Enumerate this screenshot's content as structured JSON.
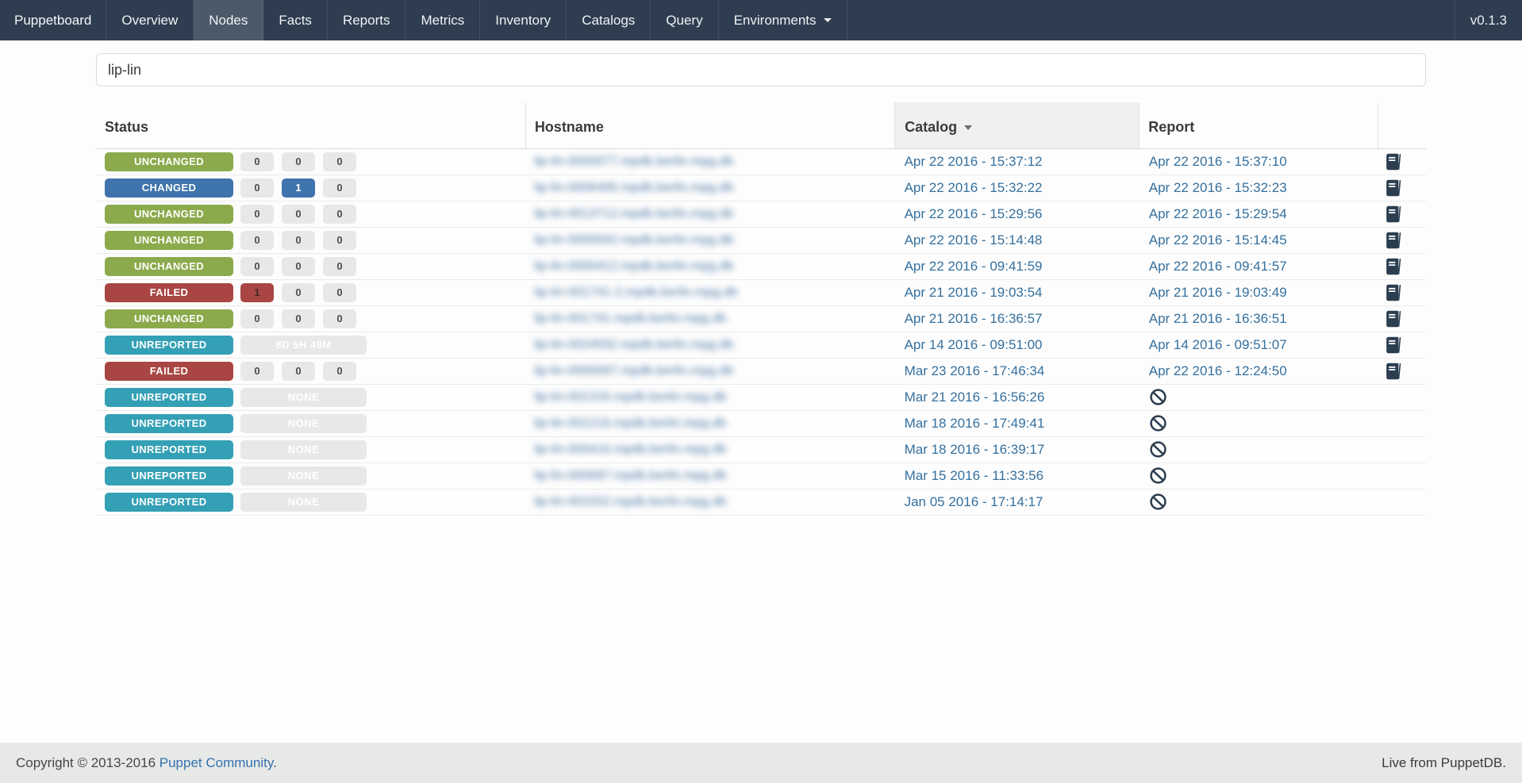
{
  "navbar": {
    "brand": "Puppetboard",
    "items": [
      {
        "label": "Overview",
        "active": false,
        "dropdown": false
      },
      {
        "label": "Nodes",
        "active": true,
        "dropdown": false
      },
      {
        "label": "Facts",
        "active": false,
        "dropdown": false
      },
      {
        "label": "Reports",
        "active": false,
        "dropdown": false
      },
      {
        "label": "Metrics",
        "active": false,
        "dropdown": false
      },
      {
        "label": "Inventory",
        "active": false,
        "dropdown": false
      },
      {
        "label": "Catalogs",
        "active": false,
        "dropdown": false
      },
      {
        "label": "Query",
        "active": false,
        "dropdown": false
      },
      {
        "label": "Environments",
        "active": false,
        "dropdown": true
      }
    ],
    "version": "v0.1.3"
  },
  "search": {
    "value": "lip-lin",
    "placeholder": ""
  },
  "table": {
    "headers": {
      "status": "Status",
      "hostname": "Hostname",
      "catalog": "Catalog",
      "report": "Report"
    },
    "sorted_column": "catalog",
    "sort_direction": "desc",
    "hostnames_redacted": true,
    "rows": [
      {
        "status": "UNCHANGED",
        "status_key": "unchanged",
        "counts": [
          {
            "v": "0"
          },
          {
            "v": "0"
          },
          {
            "v": "0"
          }
        ],
        "hostname": "lip-lin-0000077.mpdb.berlin.mpg.db",
        "catalog": "Apr 22 2016 - 15:37:12",
        "report": "Apr 22 2016 - 15:37:10",
        "has_report_doc": true
      },
      {
        "status": "CHANGED",
        "status_key": "changed",
        "counts": [
          {
            "v": "0"
          },
          {
            "v": "1",
            "t": "changed"
          },
          {
            "v": "0"
          }
        ],
        "hostname": "lip-lin-0006495.mpdb.berlin.mpg.db",
        "catalog": "Apr 22 2016 - 15:32:22",
        "report": "Apr 22 2016 - 15:32:23",
        "has_report_doc": true
      },
      {
        "status": "UNCHANGED",
        "status_key": "unchanged",
        "counts": [
          {
            "v": "0"
          },
          {
            "v": "0"
          },
          {
            "v": "0"
          }
        ],
        "hostname": "lip-lin-0013712.mpdb.berlin.mpg.db",
        "catalog": "Apr 22 2016 - 15:29:56",
        "report": "Apr 22 2016 - 15:29:54",
        "has_report_doc": true
      },
      {
        "status": "UNCHANGED",
        "status_key": "unchanged",
        "counts": [
          {
            "v": "0"
          },
          {
            "v": "0"
          },
          {
            "v": "0"
          }
        ],
        "hostname": "lip-lin-0009592.mpdb.berlin.mpg.db",
        "catalog": "Apr 22 2016 - 15:14:48",
        "report": "Apr 22 2016 - 15:14:45",
        "has_report_doc": true
      },
      {
        "status": "UNCHANGED",
        "status_key": "unchanged",
        "counts": [
          {
            "v": "0"
          },
          {
            "v": "0"
          },
          {
            "v": "0"
          }
        ],
        "hostname": "lip-lin-0000412.mpdb.berlin.mpg.db",
        "catalog": "Apr 22 2016 - 09:41:59",
        "report": "Apr 22 2016 - 09:41:57",
        "has_report_doc": true
      },
      {
        "status": "FAILED",
        "status_key": "failed",
        "counts": [
          {
            "v": "1",
            "t": "failed"
          },
          {
            "v": "0"
          },
          {
            "v": "0"
          }
        ],
        "hostname": "lip-lin-001741-2.mpdb.berlin.mpg.db",
        "catalog": "Apr 21 2016 - 19:03:54",
        "report": "Apr 21 2016 - 19:03:49",
        "has_report_doc": true
      },
      {
        "status": "UNCHANGED",
        "status_key": "unchanged",
        "counts": [
          {
            "v": "0"
          },
          {
            "v": "0"
          },
          {
            "v": "0"
          }
        ],
        "hostname": "lip-lin-001741.mpdb.berlin.mpg.db",
        "catalog": "Apr 21 2016 - 16:36:57",
        "report": "Apr 21 2016 - 16:36:51",
        "has_report_doc": true
      },
      {
        "status": "UNREPORTED",
        "status_key": "unreported",
        "wide_count": "8D 5H 49M",
        "hostname": "lip-lin-0024592.mpdb.berlin.mpg.db",
        "catalog": "Apr 14 2016 - 09:51:00",
        "report": "Apr 14 2016 - 09:51:07",
        "has_report_doc": true
      },
      {
        "status": "FAILED",
        "status_key": "failed",
        "counts": [
          {
            "v": "0"
          },
          {
            "v": "0"
          },
          {
            "v": "0"
          }
        ],
        "hostname": "lip-lin-0000097.mpdb.berlin.mpg.db",
        "catalog": "Mar 23 2016 - 17:46:34",
        "report": "Apr 22 2016 - 12:24:50",
        "has_report_doc": true
      },
      {
        "status": "UNREPORTED",
        "status_key": "unreported",
        "wide_count": "NONE",
        "hostname": "lip-lin-001316.mpdb.berlin.mpg.db",
        "catalog": "Mar 21 2016 - 16:56:26",
        "report": null,
        "has_report_doc": false
      },
      {
        "status": "UNREPORTED",
        "status_key": "unreported",
        "wide_count": "NONE",
        "hostname": "lip-lin-001216.mpdb.berlin.mpg.db",
        "catalog": "Mar 18 2016 - 17:49:41",
        "report": null,
        "has_report_doc": false
      },
      {
        "status": "UNREPORTED",
        "status_key": "unreported",
        "wide_count": "NONE",
        "hostname": "lip-lin-000416.mpdb.berlin.mpg.db",
        "catalog": "Mar 18 2016 - 16:39:17",
        "report": null,
        "has_report_doc": false
      },
      {
        "status": "UNREPORTED",
        "status_key": "unreported",
        "wide_count": "NONE",
        "hostname": "lip-lin-000687.mpdb.berlin.mpg.db",
        "catalog": "Mar 15 2016 - 11:33:56",
        "report": null,
        "has_report_doc": false
      },
      {
        "status": "UNREPORTED",
        "status_key": "unreported",
        "wide_count": "NONE",
        "hostname": "lip-lin-001552.mpdb.berlin.mpg.db",
        "catalog": "Jan 05 2016 - 17:14:17",
        "report": null,
        "has_report_doc": false
      }
    ]
  },
  "footer": {
    "copyright_prefix": "Copyright © 2013-2016 ",
    "copyright_link": "Puppet Community",
    "copyright_suffix": ".",
    "right_text": "Live from PuppetDB."
  },
  "colors": {
    "navbar_bg": "#2e3e50",
    "nav_active_bg": "#4a5a69",
    "status_unchanged": "#8baa4c",
    "status_changed": "#3e73ad",
    "status_failed": "#a94643",
    "status_unreported": "#34a0b5",
    "link_blue": "#35709e",
    "pill_bg": "#e8e8e8",
    "sorted_header_bg": "#f0f0ee",
    "footer_bg": "#e7e9e7"
  },
  "icons": {
    "environments_caret": "chevron-down-icon",
    "catalog_sort": "sort-desc-icon",
    "report_present": "book-icon",
    "report_missing": "ban-icon"
  }
}
